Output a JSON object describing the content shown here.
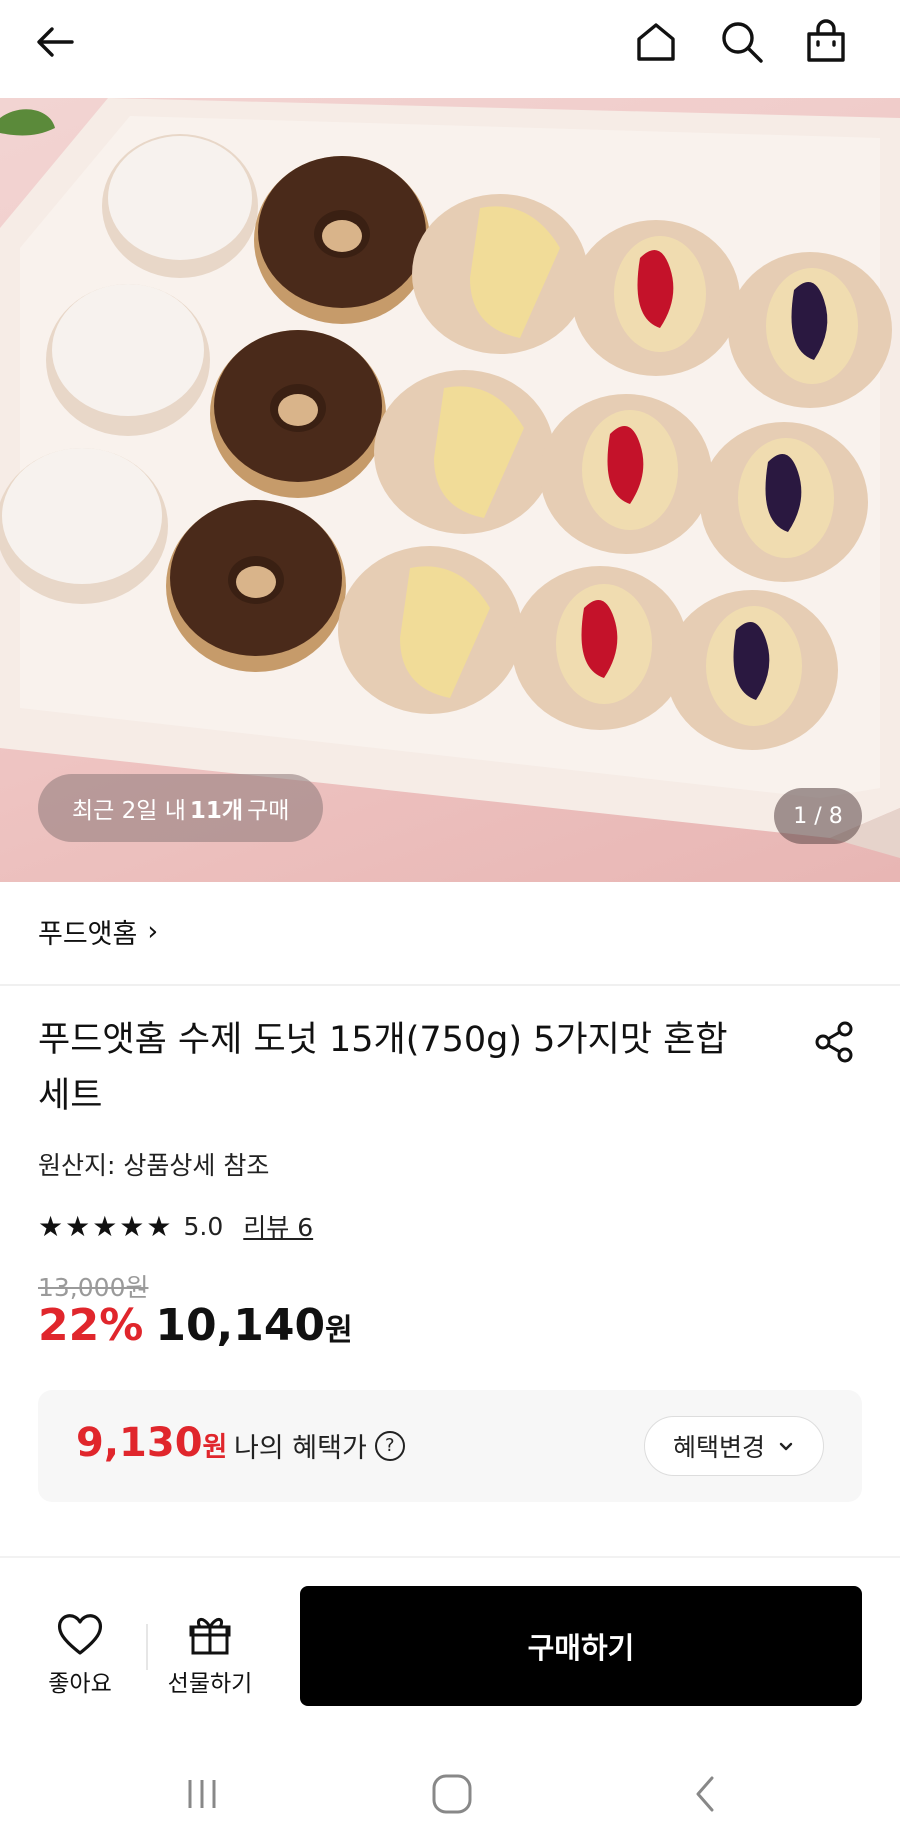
{
  "topbar": {
    "icons": [
      "back-arrow-icon",
      "home-icon",
      "search-icon",
      "shopping-bag-icon"
    ]
  },
  "hero": {
    "purchase_prefix": "최근 2일 내",
    "purchase_count": "11개",
    "purchase_suffix": "구매",
    "counter": "1 / 8"
  },
  "brand": {
    "name": "푸드앳홈",
    "chevron": "›"
  },
  "product": {
    "title": "푸드앳홈 수제 도넛 15개(750g) 5가지맛 혼합세트",
    "origin": "원산지: 상품상세 참조",
    "stars": "★★★★★",
    "rating": "5.0",
    "review_link": "리뷰 6",
    "original_price": "13,000원",
    "discount": "22%",
    "price": "10,140",
    "price_unit": "원"
  },
  "benefit": {
    "price": "9,130",
    "price_unit": "원",
    "label": "나의 혜택가",
    "help_icon": "?",
    "change_button": "혜택변경"
  },
  "actions": {
    "like_label": "좋아요",
    "gift_label": "선물하기",
    "buy_label": "구매하기"
  },
  "colors": {
    "accent_red": "#e0262c",
    "buy_button": "#000000"
  }
}
